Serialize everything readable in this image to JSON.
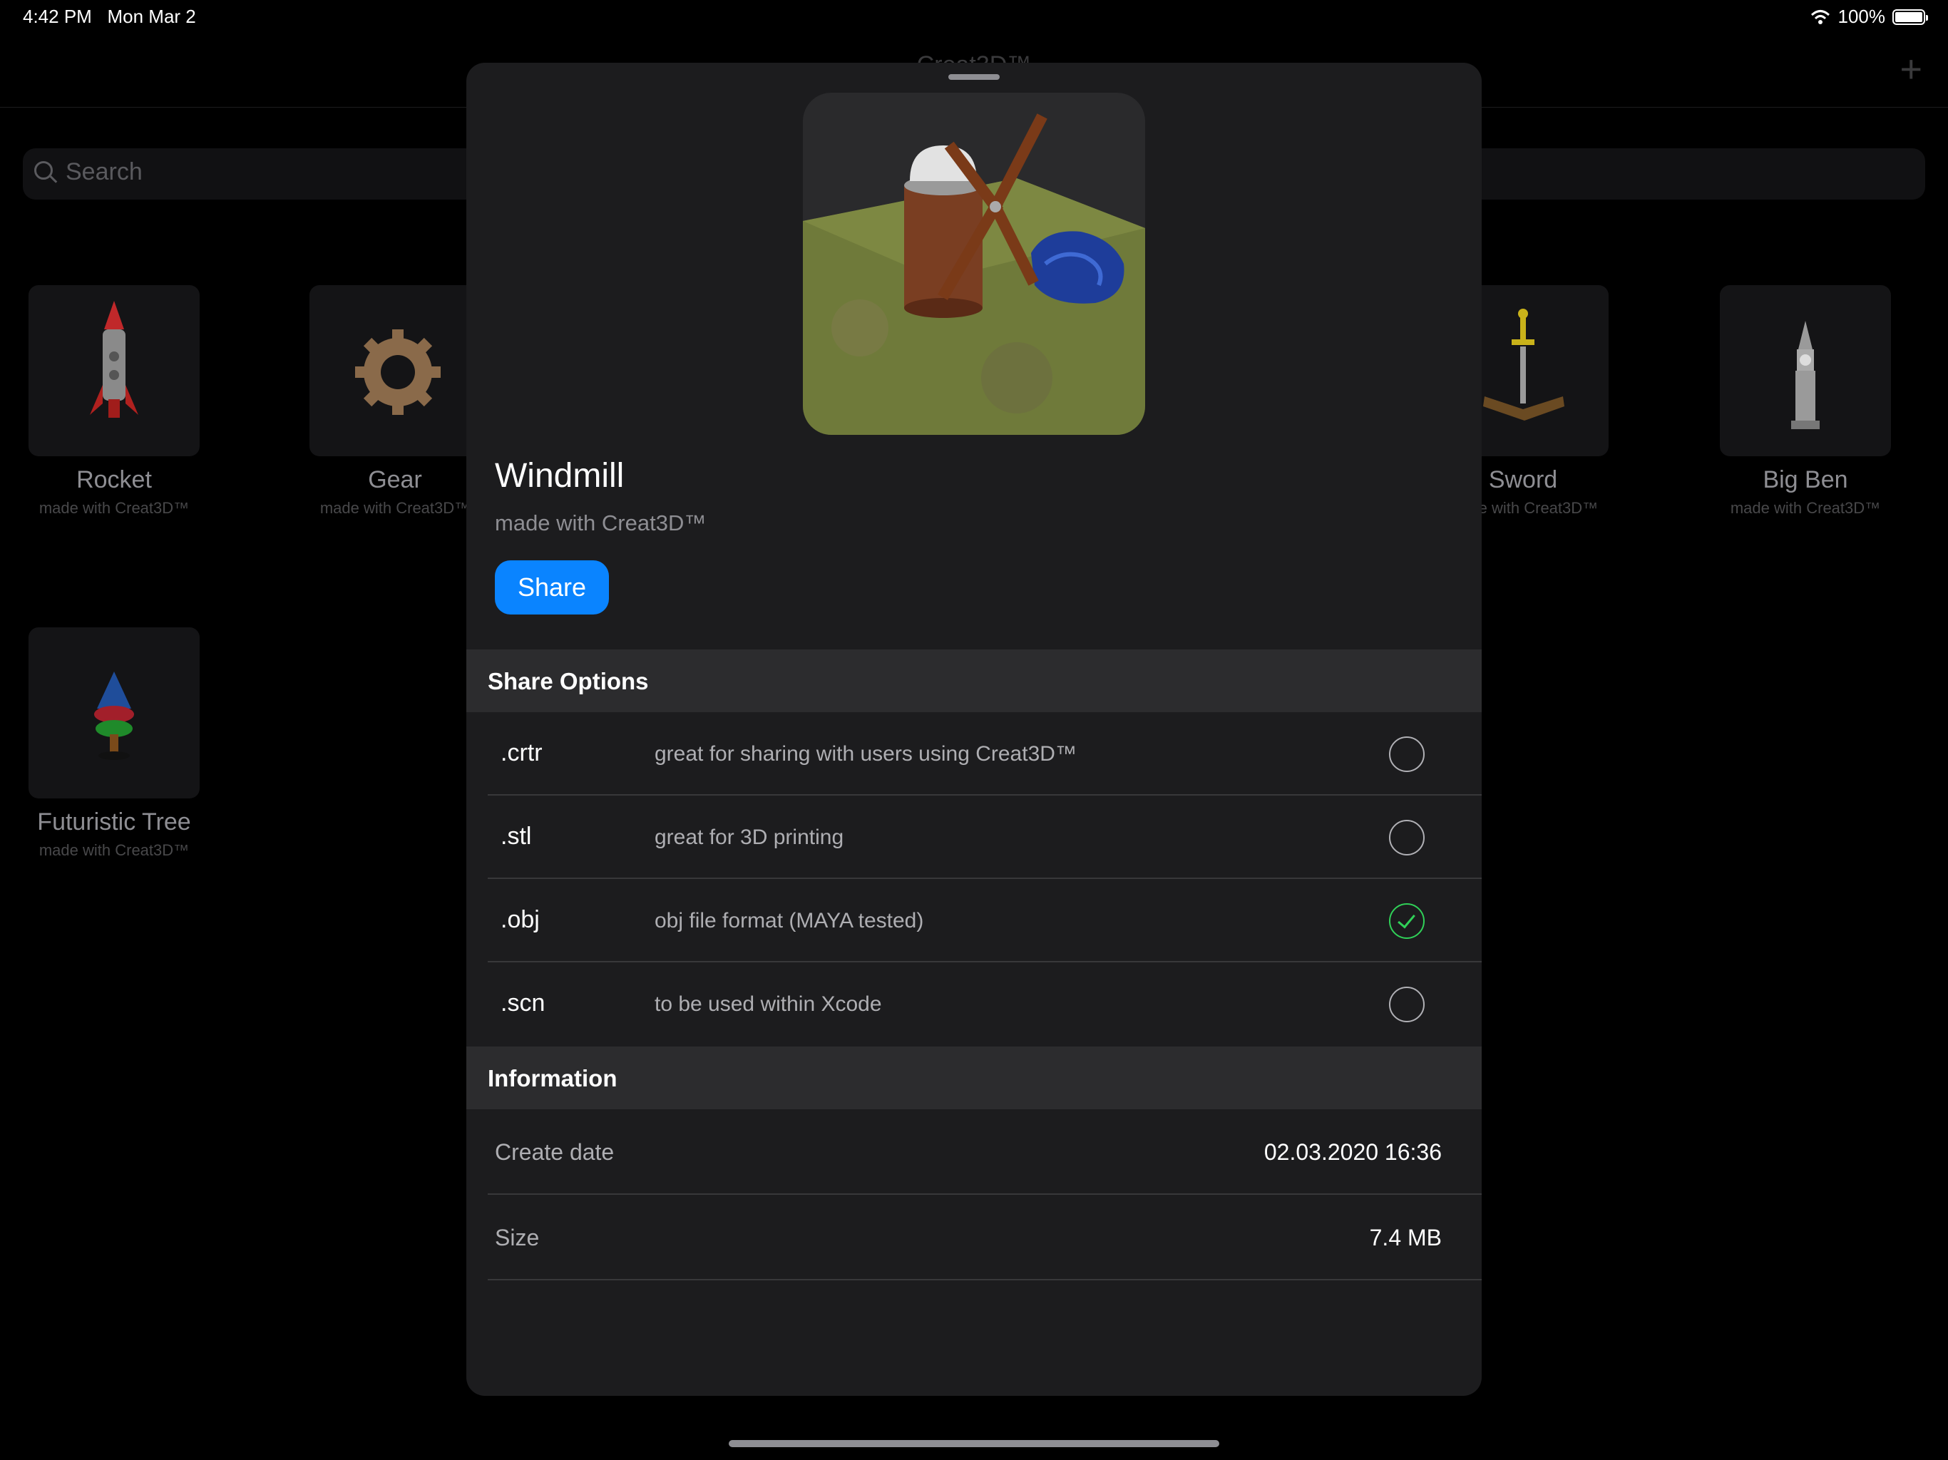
{
  "status_bar": {
    "time": "4:42 PM",
    "date": "Mon Mar 2",
    "battery": "100%"
  },
  "background": {
    "nav_title": "Creat3D™",
    "search_placeholder": "Search",
    "models": [
      {
        "name": "Rocket",
        "subtitle": "made with Creat3D™"
      },
      {
        "name": "Gear",
        "subtitle": "made with Creat3D™"
      },
      {
        "name": "Sword",
        "subtitle": "made with Creat3D™"
      },
      {
        "name": "Big Ben",
        "subtitle": "made with Creat3D™"
      },
      {
        "name": "Futuristic Tree",
        "subtitle": "made with Creat3D™"
      }
    ]
  },
  "sheet": {
    "title": "Windmill",
    "subtitle": "made with Creat3D™",
    "share_label": "Share",
    "share_options_header": "Share Options",
    "options": [
      {
        "ext": ".crtr",
        "desc": "great for sharing with users using Creat3D™",
        "selected": false
      },
      {
        "ext": ".stl",
        "desc": "great for 3D printing",
        "selected": false
      },
      {
        "ext": ".obj",
        "desc": "obj file format (MAYA tested)",
        "selected": true
      },
      {
        "ext": ".scn",
        "desc": "to be used within Xcode",
        "selected": false
      }
    ],
    "information_header": "Information",
    "info": [
      {
        "label": "Create date",
        "value": "02.03.2020 16:36"
      },
      {
        "label": "Size",
        "value": "7.4 MB"
      }
    ]
  }
}
